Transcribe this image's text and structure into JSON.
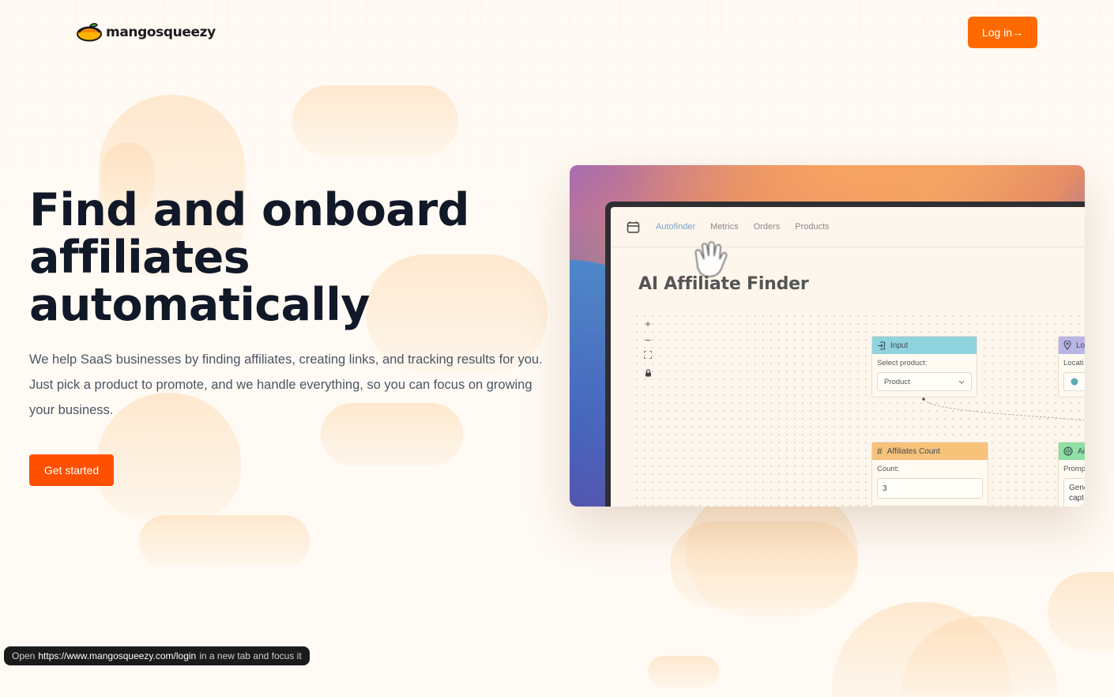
{
  "brand": {
    "name": "mangosqueezy"
  },
  "header": {
    "login_label": "Log in→"
  },
  "hero": {
    "title_lines": [
      "Find and onboard",
      "affiliates",
      "automatically"
    ],
    "subtitle": "We help SaaS businesses by finding affiliates, creating links, and tracking results for you. Just pick a product to promote, and we handle everything, so you can focus on growing your business.",
    "cta_label": "Get started"
  },
  "preview": {
    "tabs": [
      "Autofinder",
      "Metrics",
      "Orders",
      "Products"
    ],
    "active_tab": "Autofinder",
    "title": "AI Affiliate Finder",
    "zoom_controls": [
      "+",
      "−",
      "⛶",
      "🔒"
    ],
    "nodes": {
      "input": {
        "header": "Input",
        "label": "Select product:",
        "value": "Product"
      },
      "location": {
        "header": "Lo",
        "label": "Locati"
      },
      "affiliates_count": {
        "header": "Affiliates Count",
        "label": "Count:",
        "value": "3"
      },
      "ai": {
        "header": "Ai",
        "label": "Promp",
        "value_lines": [
          "Gene",
          "capt"
        ]
      }
    },
    "colors": {
      "input_header": "#8fd3de",
      "location_header": "#b9b5e6",
      "count_header": "#f7c27a",
      "ai_header": "#8ee0a5"
    }
  },
  "status_bar": {
    "prefix": "Open",
    "url": "https://www.mangosqueezy.com/login",
    "suffix": "in a new tab and focus it"
  },
  "colors": {
    "accent": "#ff6a00",
    "cta": "#ff4f00",
    "background": "#fffaf4"
  }
}
